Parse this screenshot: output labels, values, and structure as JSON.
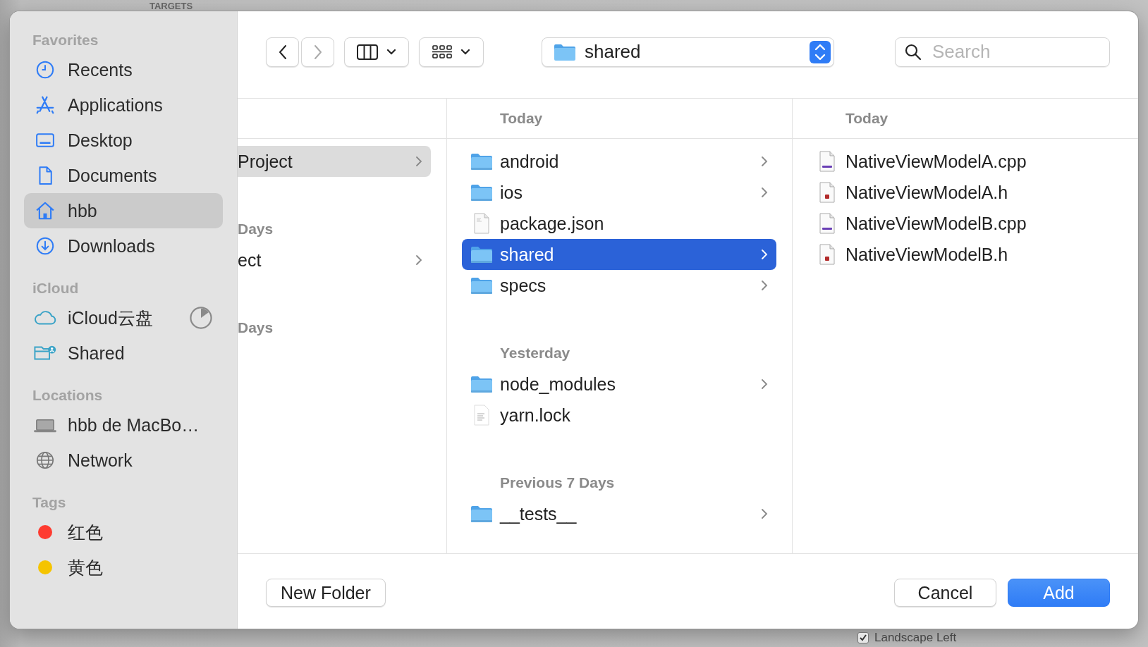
{
  "backdrop": {
    "heading": "TARGETS",
    "checkbox": {
      "label": "Landscape Left",
      "checked": true
    }
  },
  "sidebar": {
    "sections": [
      {
        "title": "Favorites",
        "items": [
          {
            "label": "Recents",
            "kind": "clock",
            "selected": false
          },
          {
            "label": "Applications",
            "kind": "apps",
            "selected": false
          },
          {
            "label": "Desktop",
            "kind": "desktop",
            "selected": false
          },
          {
            "label": "Documents",
            "kind": "document",
            "selected": false
          },
          {
            "label": "hbb",
            "kind": "home",
            "selected": true
          },
          {
            "label": "Downloads",
            "kind": "download",
            "selected": false
          }
        ]
      },
      {
        "title": "iCloud",
        "items": [
          {
            "label": "iCloud云盘",
            "kind": "cloud",
            "selected": false
          },
          {
            "label": "Shared",
            "kind": "shared-folder",
            "selected": false
          }
        ]
      },
      {
        "title": "Locations",
        "items": [
          {
            "label": "hbb de MacBo…",
            "kind": "laptop",
            "selected": false
          },
          {
            "label": "Network",
            "kind": "globe",
            "selected": false
          }
        ]
      },
      {
        "title": "Tags",
        "items": [
          {
            "label": "红色",
            "kind": "tag",
            "color": "#fe3b30",
            "selected": false
          },
          {
            "label": "黄色",
            "kind": "tag",
            "color": "#f5c400",
            "selected": false
          }
        ]
      }
    ]
  },
  "toolbar": {
    "back": {
      "disabled": false
    },
    "forward": {
      "disabled": true
    },
    "location": "shared",
    "search": {
      "placeholder": "Search"
    }
  },
  "columns": [
    {
      "focused": false,
      "entries": [
        {
          "kind": "plain",
          "label": "Project",
          "selected": true,
          "disclosure": true
        },
        {
          "kind": "header",
          "label": "Days"
        },
        {
          "kind": "plain",
          "label": "ect",
          "selected": false,
          "disclosure": true
        },
        {
          "kind": "header",
          "label": "Days"
        }
      ]
    },
    {
      "header": "Today",
      "focused": true,
      "entries": [
        {
          "kind": "folder",
          "label": "android",
          "selected": false,
          "disclosure": true
        },
        {
          "kind": "folder",
          "label": "ios",
          "selected": false,
          "disclosure": true
        },
        {
          "kind": "file",
          "label": "package.json",
          "selected": false,
          "disclosure": false
        },
        {
          "kind": "folder",
          "label": "shared",
          "selected": true,
          "disclosure": true
        },
        {
          "kind": "folder",
          "label": "specs",
          "selected": false,
          "disclosure": true
        },
        {
          "kind": "header",
          "label": "Yesterday"
        },
        {
          "kind": "folder",
          "label": "node_modules",
          "selected": false,
          "disclosure": true
        },
        {
          "kind": "text",
          "label": "yarn.lock",
          "selected": false,
          "disclosure": false
        },
        {
          "kind": "header",
          "label": "Previous 7 Days"
        },
        {
          "kind": "folder",
          "label": "__tests__",
          "selected": false,
          "disclosure": true
        }
      ]
    },
    {
      "header": "Today",
      "entries": [
        {
          "kind": "cpp",
          "label": "NativeViewModelA.cpp",
          "selected": false,
          "disclosure": false
        },
        {
          "kind": "h",
          "label": "NativeViewModelA.h",
          "selected": false,
          "disclosure": false
        },
        {
          "kind": "cpp",
          "label": "NativeViewModelB.cpp",
          "selected": false,
          "disclosure": false
        },
        {
          "kind": "h",
          "label": "NativeViewModelB.h",
          "selected": false,
          "disclosure": false
        }
      ]
    }
  ],
  "footer": {
    "left_buttons": [
      {
        "label": "New Folder",
        "kind": "plain"
      }
    ],
    "right_buttons": [
      {
        "label": "Cancel",
        "kind": "plain"
      },
      {
        "label": "Add",
        "kind": "primary"
      }
    ]
  }
}
